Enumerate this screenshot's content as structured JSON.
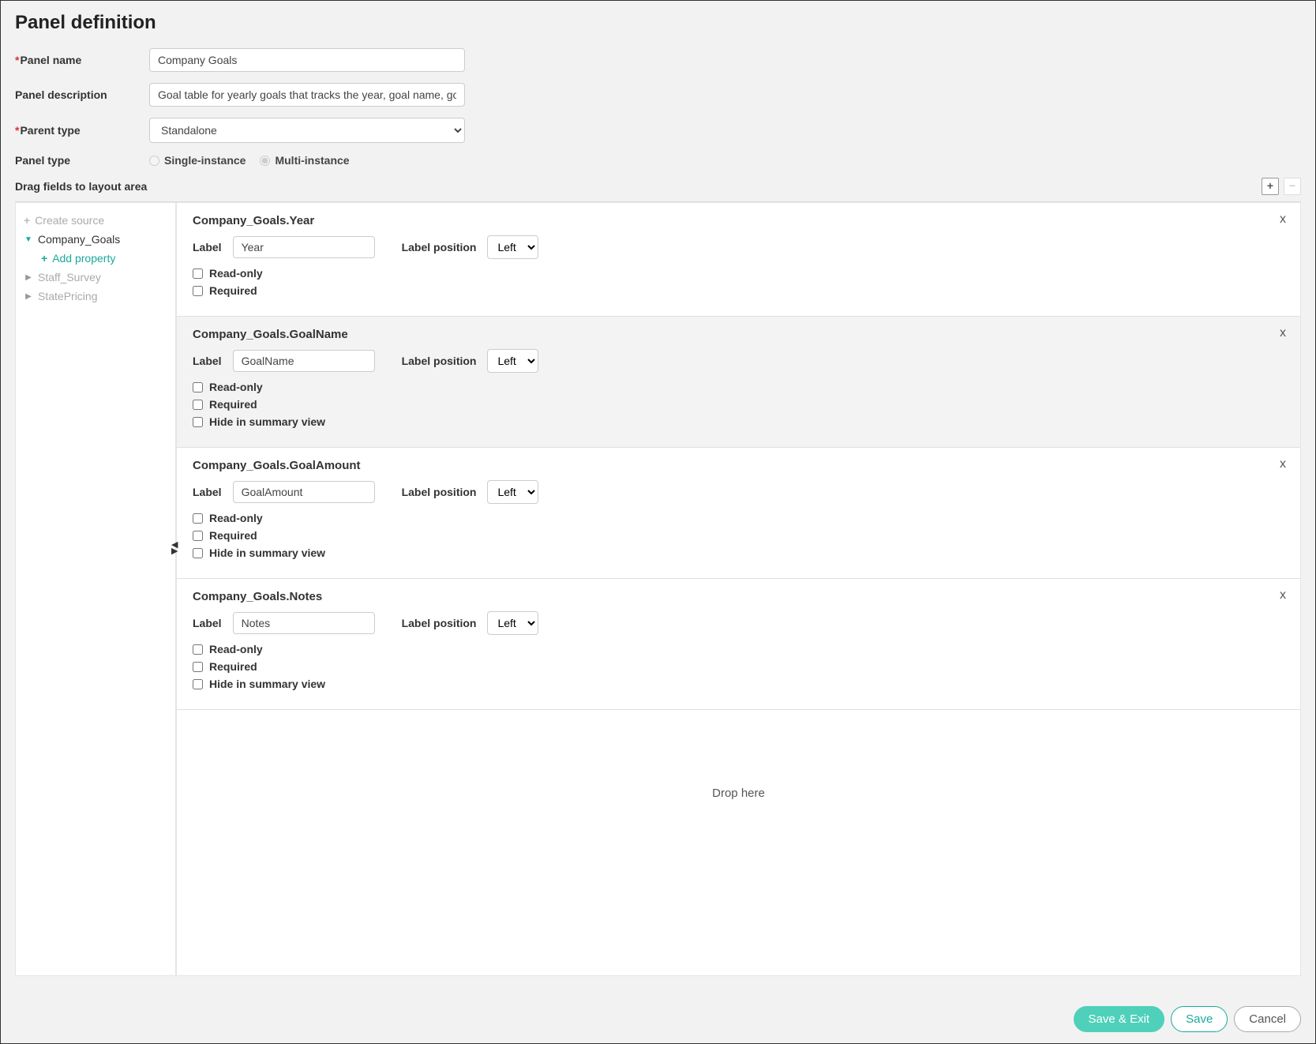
{
  "title": "Panel definition",
  "labels": {
    "panel_name": "Panel name",
    "panel_description": "Panel description",
    "parent_type": "Parent type",
    "panel_type": "Panel type",
    "single": "Single-instance",
    "multi": "Multi-instance",
    "drag_header": "Drag fields to layout area",
    "field_label": "Label",
    "label_position": "Label position",
    "read_only": "Read-only",
    "required": "Required",
    "hide_summary": "Hide in summary view",
    "drop_here": "Drop here"
  },
  "values": {
    "panel_name": "Company Goals",
    "panel_description": "Goal table for yearly goals that tracks the year, goal name, goal amount, and notes",
    "parent_type": "Standalone",
    "panel_type_selected": "multi"
  },
  "sidebar": {
    "create_source": "Create source",
    "add_property": "Add property",
    "items": [
      {
        "name": "Company_Goals",
        "expanded": true,
        "active": true
      },
      {
        "name": "Staff_Survey",
        "expanded": false,
        "active": false
      },
      {
        "name": "StatePricing",
        "expanded": false,
        "active": false
      }
    ]
  },
  "fields": [
    {
      "title": "Company_Goals.Year",
      "label_value": "Year",
      "position": "Left",
      "show_hide_summary": false,
      "alt": false
    },
    {
      "title": "Company_Goals.GoalName",
      "label_value": "GoalName",
      "position": "Left",
      "show_hide_summary": true,
      "alt": true
    },
    {
      "title": "Company_Goals.GoalAmount",
      "label_value": "GoalAmount",
      "position": "Left",
      "show_hide_summary": true,
      "alt": false
    },
    {
      "title": "Company_Goals.Notes",
      "label_value": "Notes",
      "position": "Left",
      "show_hide_summary": true,
      "alt": false
    }
  ],
  "footer": {
    "save_exit": "Save & Exit",
    "save": "Save",
    "cancel": "Cancel"
  }
}
